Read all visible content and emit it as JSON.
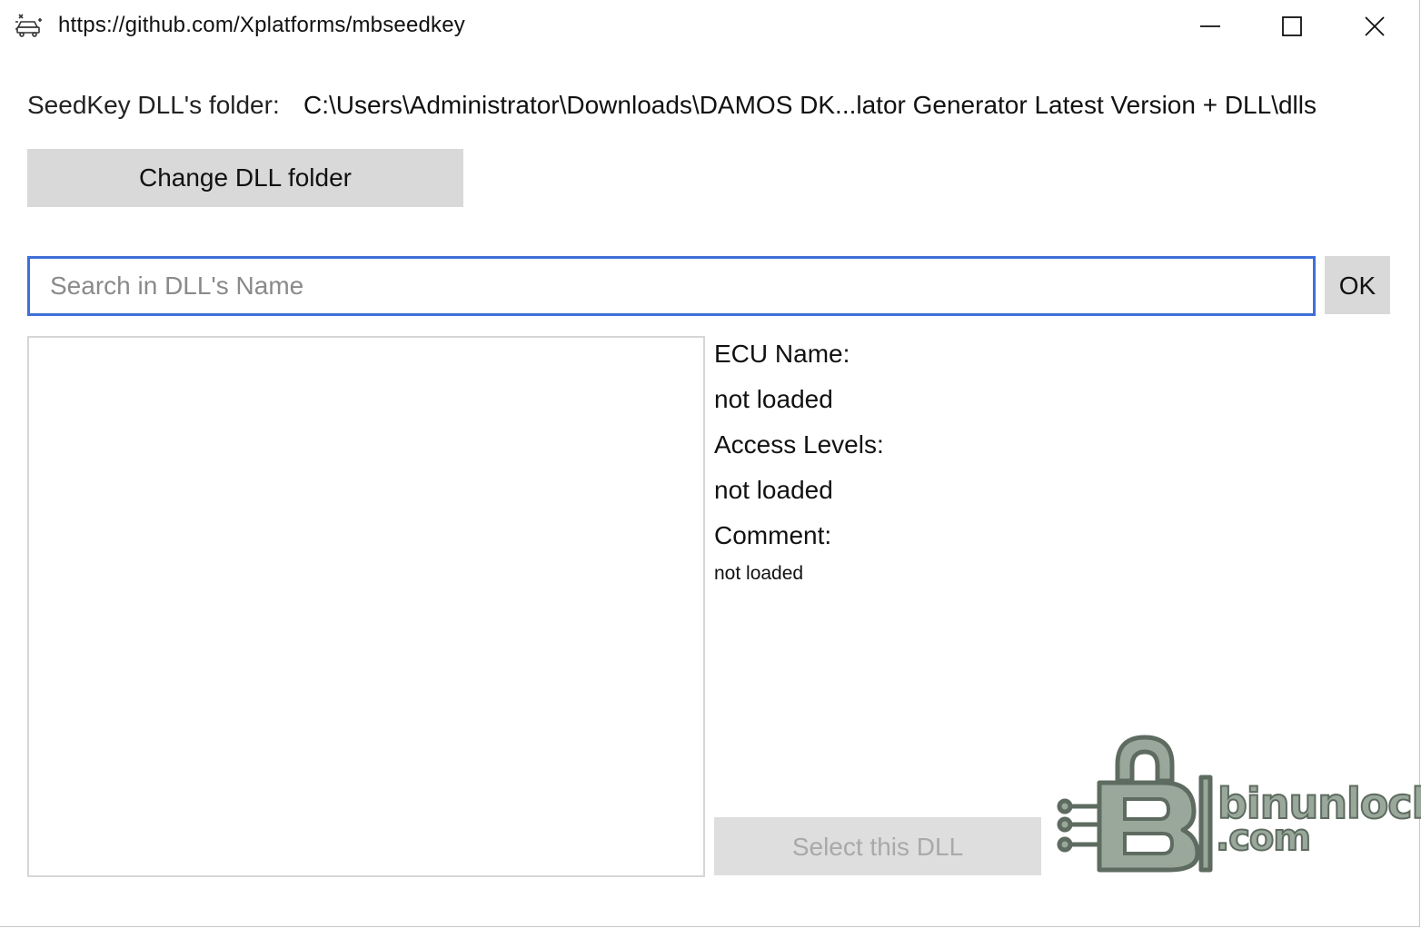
{
  "window": {
    "title": "https://github.com/Xplatforms/mbseedkey",
    "app_icon": "car-network-icon",
    "controls": [
      "minimize-icon",
      "maximize-icon",
      "close-icon"
    ]
  },
  "folder": {
    "label": "SeedKey DLL's folder:",
    "path": "C:\\Users\\Administrator\\Downloads\\DAMOS DK...lator Generator Latest Version + DLL\\dlls",
    "change_button": "Change DLL folder"
  },
  "search": {
    "placeholder": "Search in DLL's Name",
    "value": "",
    "ok_button": "OK"
  },
  "dll_list": {
    "items": []
  },
  "info": {
    "ecu_label": "ECU Name:",
    "ecu_value": "not loaded",
    "access_label": "Access Levels:",
    "access_value": "not loaded",
    "comment_label": "Comment:",
    "comment_value": "not loaded"
  },
  "select_button": "Select this DLL",
  "watermark": {
    "line1": "binunlock",
    "line2": ".com"
  },
  "colors": {
    "accent": "#3f6fd8",
    "button_bg": "#d9d9d9",
    "disabled_text": "#a9a9a9",
    "watermark": "#9aa89b"
  }
}
